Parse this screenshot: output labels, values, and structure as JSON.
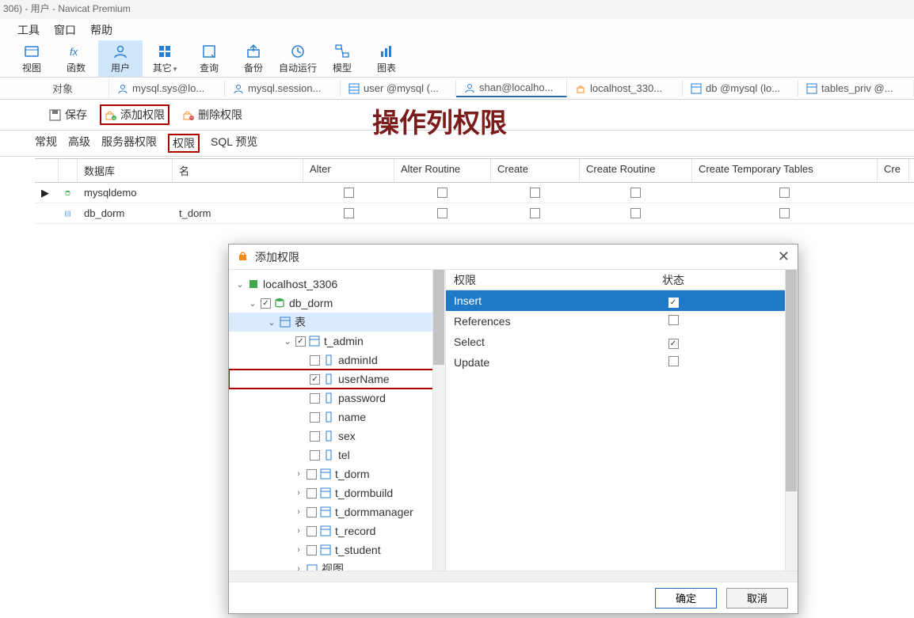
{
  "window": {
    "title": "306) - 用户 - Navicat Premium"
  },
  "menu": {
    "tools": "工具",
    "window": "窗口",
    "help": "帮助"
  },
  "toolbar": {
    "view": "视图",
    "function": "函数",
    "user": "用户",
    "other": "其它",
    "query": "查询",
    "backup": "备份",
    "autorun": "自动运行",
    "model": "模型",
    "chart": "图表"
  },
  "tabs": {
    "objects": "对象",
    "t1": "mysql.sys@lo...",
    "t2": "mysql.session...",
    "t3": "user @mysql (...",
    "t4": "shan@localho...",
    "t5": "localhost_330...",
    "t6": "db @mysql (lo...",
    "t7": "tables_priv @..."
  },
  "subtoolbar": {
    "save": "保存",
    "add_priv": "添加权限",
    "del_priv": "删除权限"
  },
  "subtabs": {
    "general": "常规",
    "advanced": "高级",
    "server_priv": "服务器权限",
    "priv": "权限",
    "sql_preview": "SQL 预览"
  },
  "overlay": {
    "text": "操作列权限"
  },
  "priv_table": {
    "columns": {
      "db": "数据库",
      "name": "名",
      "alter": "Alter",
      "alter_routine": "Alter Routine",
      "create": "Create",
      "create_routine": "Create Routine",
      "create_temp": "Create Temporary Tables",
      "cre": "Cre"
    },
    "rows": [
      {
        "db": "mysqldemo",
        "name": ""
      },
      {
        "db": "db_dorm",
        "name": "t_dorm"
      }
    ]
  },
  "dialog": {
    "title": "添加权限",
    "tree": {
      "root": "localhost_3306",
      "db": "db_dorm",
      "tables_group": "表",
      "t_admin": "t_admin",
      "cols": {
        "adminId": "adminId",
        "userName": "userName",
        "password": "password",
        "name": "name",
        "sex": "sex",
        "tel": "tel"
      },
      "other_tables": {
        "t_dorm": "t_dorm",
        "t_dormbuild": "t_dormbuild",
        "t_dormmanager": "t_dormmanager",
        "t_record": "t_record",
        "t_student": "t_student"
      },
      "views_group": "视图"
    },
    "priv_header": {
      "priv": "权限",
      "state": "状态"
    },
    "privs": [
      {
        "name": "Insert",
        "checked": true,
        "selected": true
      },
      {
        "name": "References",
        "checked": false,
        "selected": false
      },
      {
        "name": "Select",
        "checked": true,
        "selected": false
      },
      {
        "name": "Update",
        "checked": false,
        "selected": false
      }
    ],
    "buttons": {
      "ok": "确定",
      "cancel": "取消"
    }
  }
}
